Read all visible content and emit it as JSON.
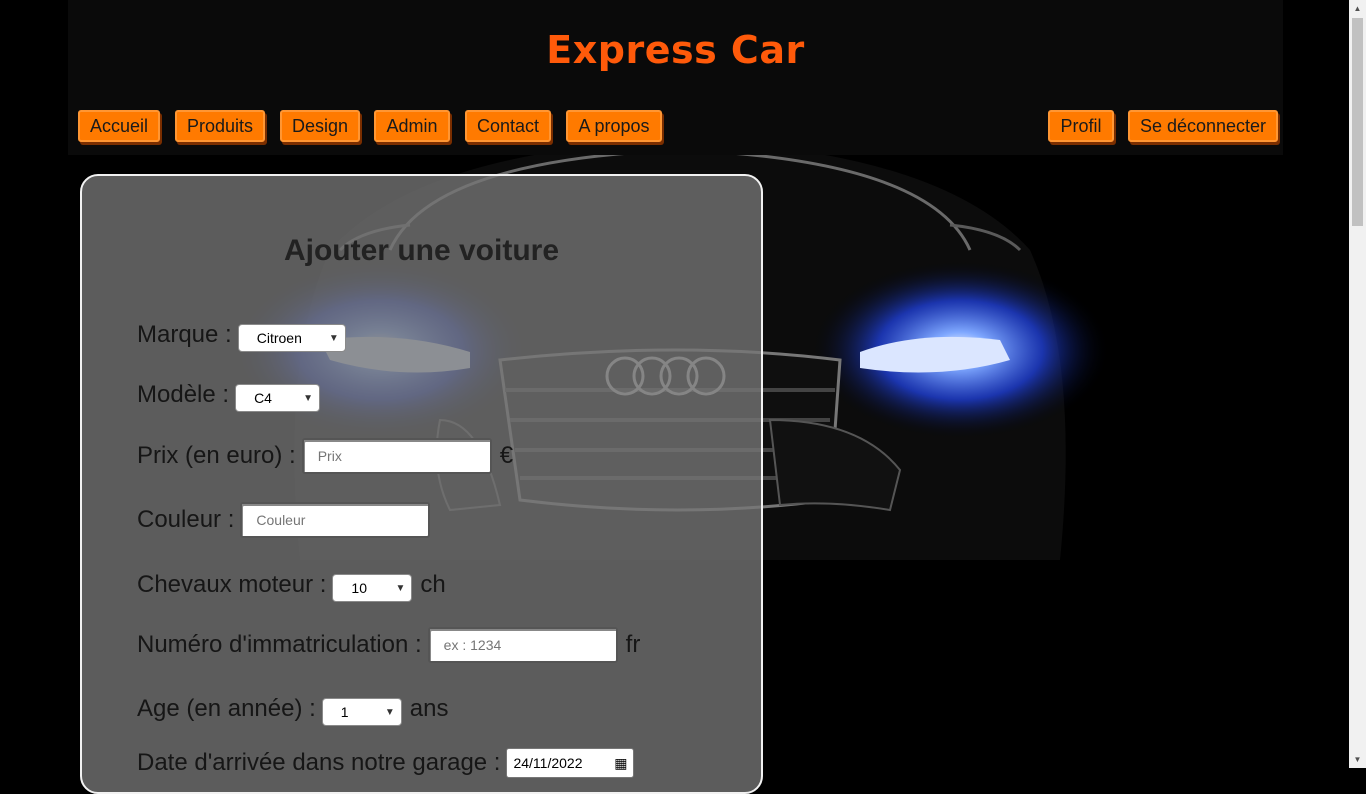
{
  "site": {
    "title": "Express Car"
  },
  "nav": {
    "left": [
      "Accueil",
      "Produits",
      "Design",
      "Admin",
      "Contact",
      "A propos"
    ],
    "right": [
      "Profil",
      "Se déconnecter"
    ]
  },
  "form": {
    "heading": "Ajouter une voiture",
    "marque": {
      "label": "Marque :",
      "value": "Citroen"
    },
    "modele": {
      "label": "Modèle :",
      "value": "C4"
    },
    "prix": {
      "label": "Prix (en euro) :",
      "placeholder": "Prix",
      "suffix": "€"
    },
    "couleur": {
      "label": "Couleur :",
      "placeholder": "Couleur"
    },
    "chevaux": {
      "label": "Chevaux moteur :",
      "value": "10",
      "suffix": "ch"
    },
    "immat": {
      "label": "Numéro d'immatriculation :",
      "placeholder": "ex : 1234",
      "suffix": "fr"
    },
    "age": {
      "label": "Age (en année) :",
      "value": "1",
      "suffix": "ans"
    },
    "date": {
      "label": "Date d'arrivée dans notre garage :",
      "value": "24/11/2022"
    }
  },
  "colors": {
    "accent": "#ff5a0a",
    "button": "#ff7a00",
    "header_bg": "#0a0a0a",
    "panel_bg": "#767676",
    "headlight": "#3a6bff"
  }
}
